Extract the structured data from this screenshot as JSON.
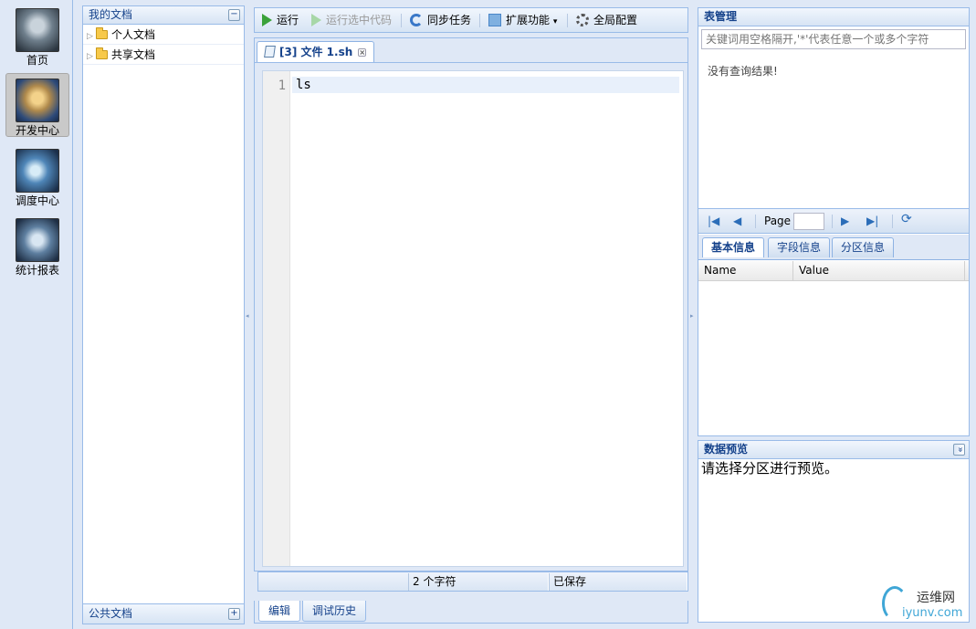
{
  "nav": {
    "items": [
      {
        "label": "首页",
        "icon": "wolf-avatar-icon",
        "color": "#6f7f8c"
      },
      {
        "label": "开发中心",
        "icon": "dev-emblem-icon",
        "color": "#b08a4c",
        "active": true
      },
      {
        "label": "调度中心",
        "icon": "dragon-icon",
        "color": "#3a5f8f"
      },
      {
        "label": "统计报表",
        "icon": "golem-icon",
        "color": "#5e7fa0"
      }
    ]
  },
  "docs": {
    "title": "我的文档",
    "collapse_glyph": "−",
    "tree": [
      {
        "label": "个人文档",
        "icon": "folder-icon"
      },
      {
        "label": "共享文档",
        "icon": "folder-icon"
      }
    ],
    "footer_title": "公共文档",
    "expand_glyph": "+"
  },
  "toolbar": {
    "run": "运行",
    "run_selected": "运行选中代码",
    "sync_task": "同步任务",
    "extensions": "扩展功能",
    "extensions_caret": "▾",
    "global_config": "全局配置"
  },
  "editor": {
    "tab_label": "[3] 文件 1.sh",
    "tab_close": "×",
    "lines": [
      {
        "number": "1",
        "text": "ls"
      }
    ]
  },
  "status": {
    "char_count": "2 个字符",
    "save_state": "已保存"
  },
  "bottom_tabs": [
    {
      "label": "编辑",
      "active": true
    },
    {
      "label": "调试历史",
      "active": false
    }
  ],
  "table_mgmt": {
    "title": "表管理",
    "search_placeholder": "关键词用空格隔开,'*'代表任意一个或多个字符",
    "no_results": "没有查询结果!",
    "pager": {
      "page_label": "Page",
      "page_value": ""
    }
  },
  "info_tabs": [
    {
      "label": "基本信息",
      "active": true
    },
    {
      "label": "字段信息",
      "active": false
    },
    {
      "label": "分区信息",
      "active": false
    }
  ],
  "info_grid": {
    "columns": [
      "Name",
      "Value"
    ]
  },
  "preview": {
    "title": "数据预览",
    "toggle_glyph": "»",
    "message": "请选择分区进行预览。"
  },
  "watermark": {
    "text": "运维网",
    "sub": "iyunv.com"
  }
}
